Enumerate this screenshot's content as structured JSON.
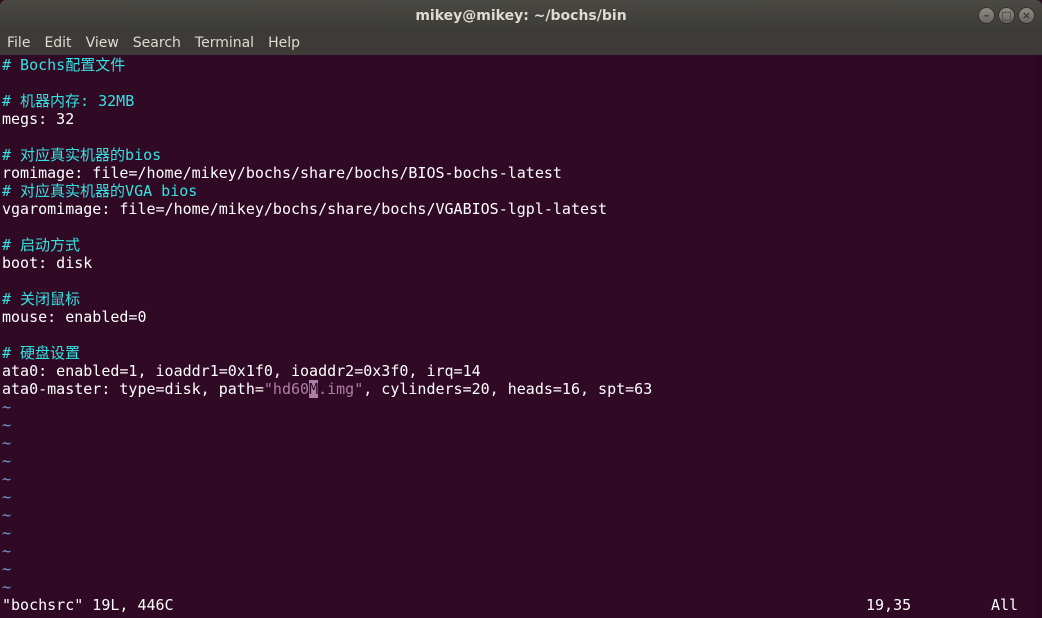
{
  "window": {
    "title": "mikey@mikey: ~/bochs/bin"
  },
  "menu": [
    "File",
    "Edit",
    "View",
    "Search",
    "Terminal",
    "Help"
  ],
  "editor": {
    "line1_comment": "# Bochs配置文件",
    "line3_comment": "# 机器内存: 32MB",
    "line4": "megs: 32",
    "line6_comment": "# 对应真实机器的bios",
    "line7": "romimage: file=/home/mikey/bochs/share/bochs/BIOS-bochs-latest",
    "line8_comment": "# 对应真实机器的VGA bios",
    "line9": "vgaromimage: file=/home/mikey/bochs/share/bochs/VGABIOS-lgpl-latest",
    "line11_comment": "# 启动方式",
    "line12": "boot: disk",
    "line14_comment": "# 关闭鼠标",
    "line15": "mouse: enabled=0",
    "line17_comment": "# 硬盘设置",
    "line18": "ata0: enabled=1, ioaddr1=0x1f0, ioaddr2=0x3f0, irq=14",
    "line19_pre": "ata0-master: type=disk, path=",
    "line19_str_a": "\"hd60",
    "line19_cursor": "M",
    "line19_str_b": ".img\"",
    "line19_post": ", cylinders=20, heads=16, spt=63",
    "tilde": "~"
  },
  "status": {
    "file_info": "\"bochsrc\" 19L, 446C",
    "position": "19,35",
    "scroll": "All"
  }
}
